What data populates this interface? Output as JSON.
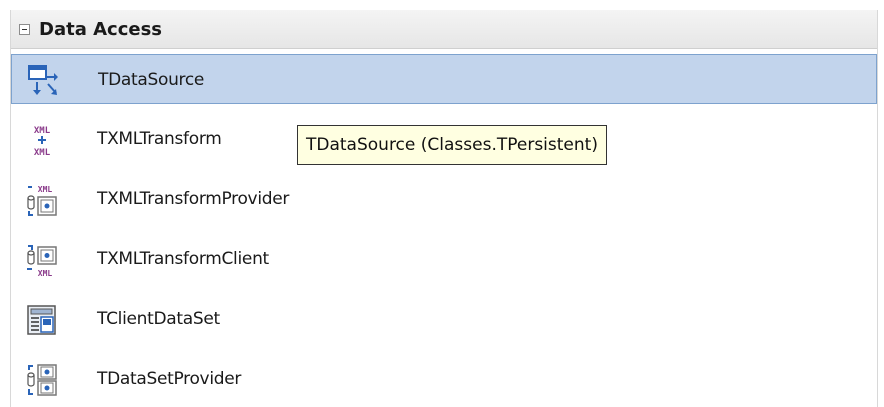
{
  "palette": {
    "category": {
      "title": "Data Access",
      "collapse_icon": "collapse-minus-icon"
    },
    "items": [
      {
        "label": "TDataSource",
        "icon": "datasource-icon",
        "selected": true
      },
      {
        "label": "TXMLTransform",
        "icon": "xml-transform-icon",
        "selected": false
      },
      {
        "label": "TXMLTransformProvider",
        "icon": "xml-transform-provider-icon",
        "selected": false
      },
      {
        "label": "TXMLTransformClient",
        "icon": "xml-transform-client-icon",
        "selected": false
      },
      {
        "label": "TClientDataSet",
        "icon": "client-dataset-icon",
        "selected": false
      },
      {
        "label": "TDataSetProvider",
        "icon": "dataset-provider-icon",
        "selected": false
      }
    ]
  },
  "tooltip": {
    "text": "TDataSource (Classes.TPersistent)"
  },
  "colors": {
    "selection_bg": "#c2d4ec",
    "selection_border": "#7da2ce",
    "tooltip_bg": "#ffffe1",
    "xml_purple": "#8a3a8a",
    "icon_blue": "#2a64b8"
  }
}
